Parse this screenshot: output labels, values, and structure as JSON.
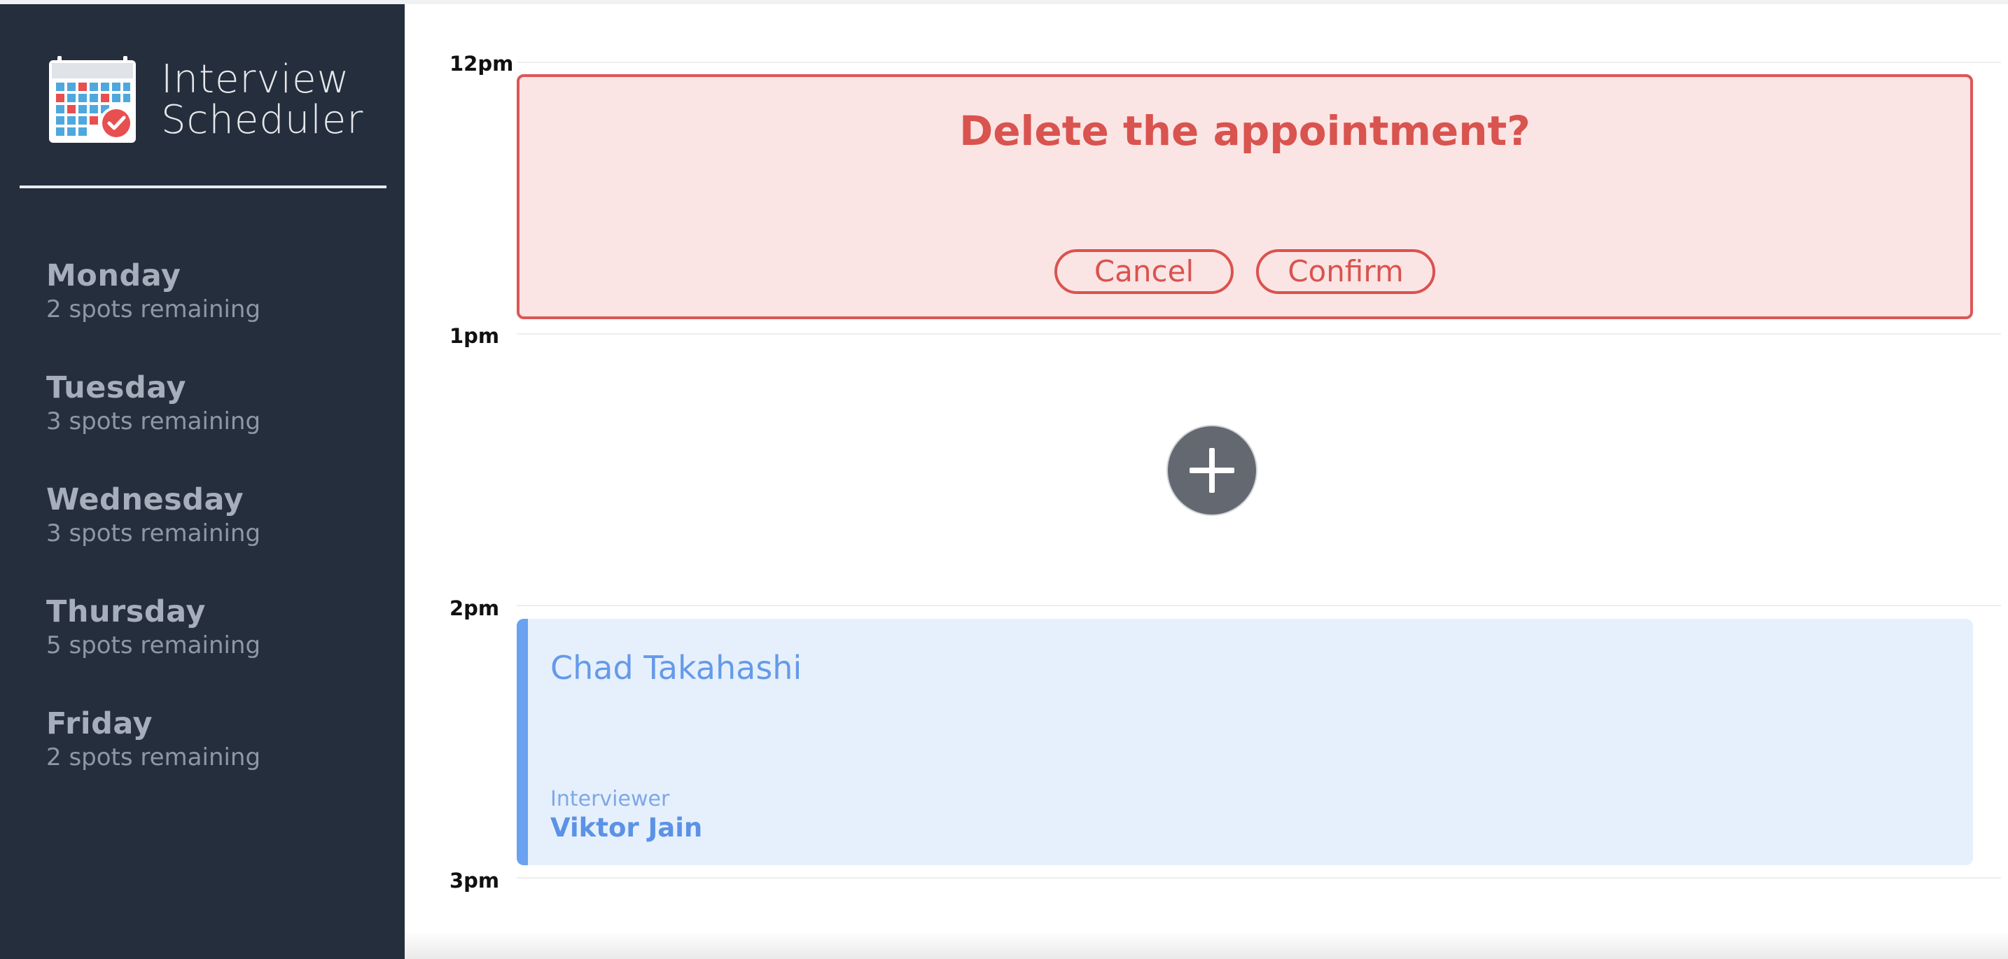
{
  "brand": {
    "line1": "Interview",
    "line2": "Scheduler",
    "logo_icon": "calendar-check-icon"
  },
  "sidebar": {
    "days": [
      {
        "name": "Monday",
        "spots": "2 spots remaining"
      },
      {
        "name": "Tuesday",
        "spots": "3 spots remaining"
      },
      {
        "name": "Wednesday",
        "spots": "3 spots remaining"
      },
      {
        "name": "Thursday",
        "spots": "5 spots remaining"
      },
      {
        "name": "Friday",
        "spots": "2 spots remaining"
      }
    ]
  },
  "schedule": {
    "times": [
      "12pm",
      "1pm",
      "2pm",
      "3pm"
    ],
    "confirm": {
      "message": "Delete the appointment?",
      "cancel_label": "Cancel",
      "confirm_label": "Confirm"
    },
    "add_icon": "plus-icon",
    "appointment": {
      "student": "Chad Takahashi",
      "interviewer_label": "Interviewer",
      "interviewer": "Viktor Jain"
    }
  },
  "colors": {
    "sidebar_bg": "#252e3c",
    "danger": "#d9534f",
    "danger_bg": "#fbe4e4",
    "booked_bg": "#e6f0fd",
    "booked_accent": "#6aa1f0",
    "add_button": "#646971"
  }
}
